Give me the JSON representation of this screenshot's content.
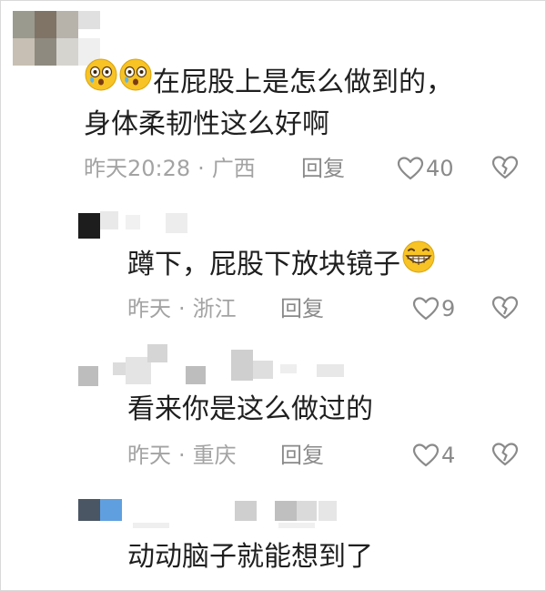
{
  "comments": [
    {
      "line1": "在屁股上是怎么做到的，",
      "line2": "身体柔韧性这么好啊",
      "time": "昨天20:28",
      "dot": "·",
      "location": "广西",
      "reply_label": "回复",
      "like_count": "40",
      "emoji": "cold-sweat-face"
    },
    {
      "text": "蹲下，屁股下放块镜子",
      "time": "昨天",
      "dot": "·",
      "location": "浙江",
      "reply_label": "回复",
      "like_count": "9",
      "emoji": "grinning-face"
    },
    {
      "text": "看来你是这么做过的",
      "time": "昨天",
      "dot": "·",
      "location": "重庆",
      "reply_label": "回复",
      "like_count": "4"
    },
    {
      "text": "动动脑子就能想到了"
    }
  ],
  "colors": {
    "text": "#1f1f1f",
    "meta": "#a3a3a3",
    "icon": "#8a8a8a",
    "emoji_face": "#f7c325"
  },
  "icons": [
    "heart-outline-icon",
    "broken-heart-icon",
    "cold-sweat-emoji",
    "grinning-emoji"
  ]
}
